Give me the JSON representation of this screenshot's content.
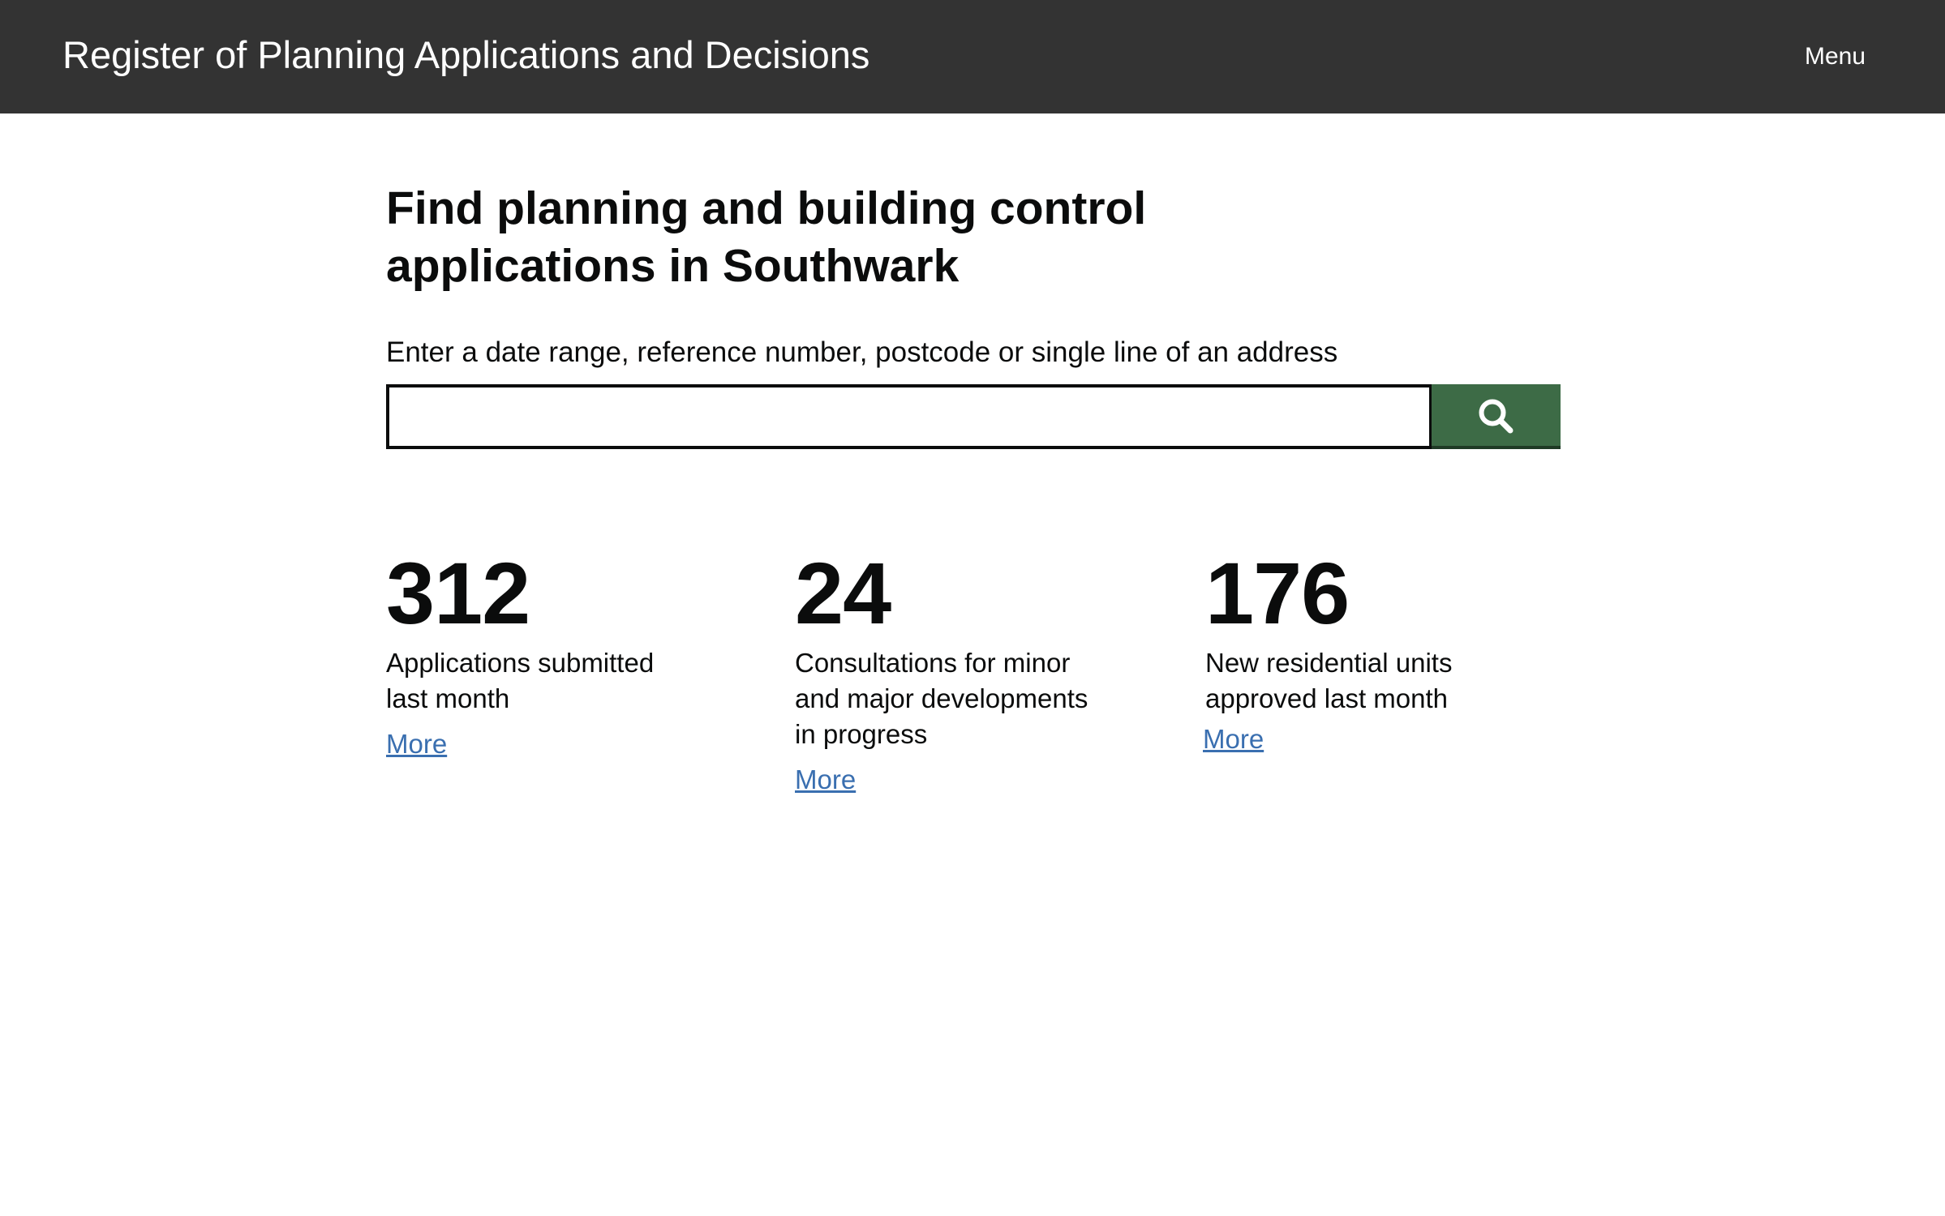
{
  "header": {
    "title": "Register of Planning Applications and Decisions",
    "menu_label": "Menu"
  },
  "main": {
    "heading": "Find planning and building control applications in Southwark",
    "search": {
      "label": "Enter a date range, reference number, postcode or single line of an address",
      "value": "",
      "placeholder": "",
      "button_icon": "search-icon"
    },
    "stats": [
      {
        "number": "312",
        "description_lines": [
          "Applications submitted",
          "last month"
        ],
        "link_label": "More"
      },
      {
        "number": "24",
        "description_lines": [
          "Consultations for minor",
          "and major developments",
          "in progress"
        ],
        "link_label": "More"
      },
      {
        "number": "176",
        "description_lines": [
          "New residential units",
          "approved last month"
        ],
        "link_label": "More"
      }
    ]
  },
  "colors": {
    "header_bg": "#333333",
    "search_button": "#3d6b46",
    "link": "#3a6fb0"
  }
}
